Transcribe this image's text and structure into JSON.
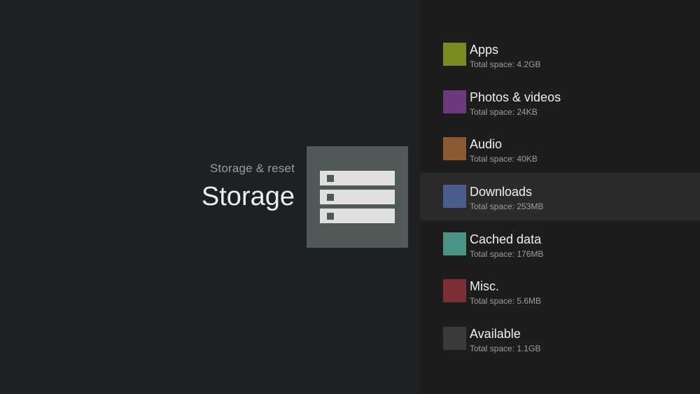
{
  "header": {
    "breadcrumb": "Storage & reset",
    "title": "Storage"
  },
  "storage_icon": {
    "name": "storage-drives-icon"
  },
  "items": [
    {
      "label": "Apps",
      "detail": "Total space: 4.2GB",
      "color": "#7a8b22"
    },
    {
      "label": "Photos & videos",
      "detail": "Total space: 24KB",
      "color": "#6e3a7f"
    },
    {
      "label": "Audio",
      "detail": "Total space: 40KB",
      "color": "#8b5a34"
    },
    {
      "label": "Downloads",
      "detail": "Total space: 253MB",
      "color": "#4a5d8d",
      "selected": true
    },
    {
      "label": "Cached data",
      "detail": "Total space: 176MB",
      "color": "#4a9387"
    },
    {
      "label": "Misc.",
      "detail": "Total space: 5.6MB",
      "color": "#7c2f36"
    },
    {
      "label": "Available",
      "detail": "Total space: 1.1GB",
      "color": "#3a3a3a"
    }
  ]
}
